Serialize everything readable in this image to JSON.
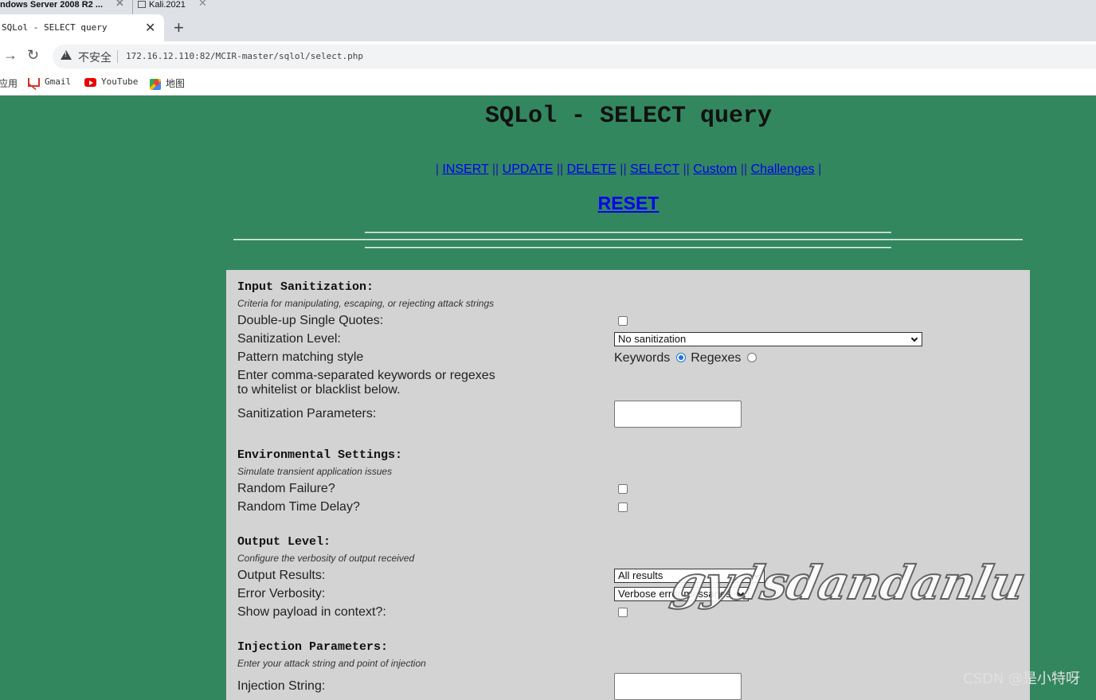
{
  "os_tabs": [
    {
      "label": "ndows Server 2008 R2 ..."
    },
    {
      "label": "Kali.2021"
    }
  ],
  "browser": {
    "tab_title": "SQLol - SELECT query",
    "new_tab": "+",
    "security_label": "不安全",
    "url": "172.16.12.110:82/MCIR-master/sqlol/select.php"
  },
  "bookmarks": {
    "apps": "应用",
    "gmail": "Gmail",
    "youtube": "YouTube",
    "maps": "地图"
  },
  "page": {
    "title": "SQLol - SELECT query",
    "nav": {
      "sep": "||",
      "links": [
        "INSERT",
        "UPDATE",
        "DELETE",
        "SELECT",
        "Custom",
        "Challenges"
      ]
    },
    "reset": "RESET"
  },
  "input_sanitization": {
    "title": "Input Sanitization:",
    "desc": "Criteria for manipulating, escaping, or rejecting attack strings",
    "double_quotes": "Double-up Single Quotes:",
    "level_label": "Sanitization Level:",
    "level_value": "No sanitization",
    "pattern_label": "Pattern matching style",
    "keywords": "Keywords",
    "regexes": "Regexes",
    "enter_line1": "Enter comma-separated keywords or regexes",
    "enter_line2": "to whitelist or blacklist below.",
    "params_label": "Sanitization Parameters:"
  },
  "environment": {
    "title": "Environmental Settings:",
    "desc": "Simulate transient application issues",
    "random_failure": "Random Failure?",
    "random_delay": "Random Time Delay?"
  },
  "output": {
    "title": "Output Level:",
    "desc": "Configure the verbosity of output received",
    "results_label": "Output Results:",
    "results_value": "All results",
    "verbosity_label": "Error Verbosity:",
    "verbosity_value": "Verbose error messages",
    "payload_label": "Show payload in context?:"
  },
  "injection": {
    "title": "Injection Parameters:",
    "desc": "Enter your attack string and point of injection",
    "string_label": "Injection String:"
  },
  "watermark": "gydsdandanlu",
  "csdn_mark": "CSDN @是小特呀"
}
